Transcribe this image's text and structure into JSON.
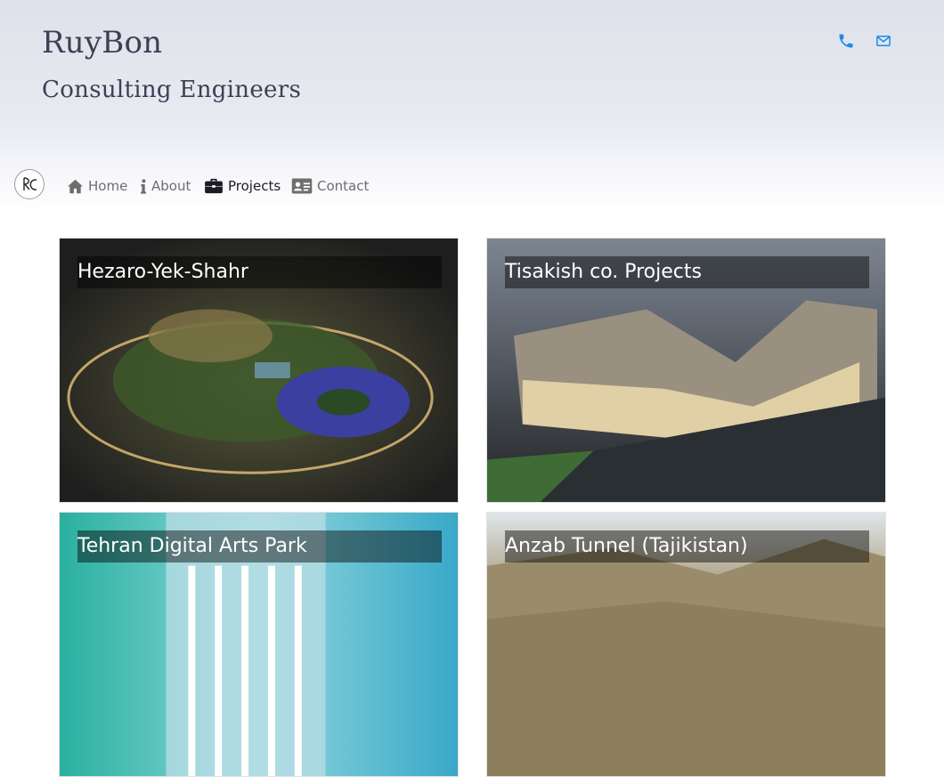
{
  "brand": {
    "title": "RuyBon",
    "subtitle": "Consulting Engineers",
    "logo_text": "RC"
  },
  "contact_icons": [
    {
      "icon": "phone-icon",
      "color": "#1a8cf0"
    },
    {
      "icon": "envelope-icon",
      "color": "#1a8cf0"
    }
  ],
  "nav": {
    "items": [
      {
        "label": "Home",
        "icon": "home-icon",
        "active": false
      },
      {
        "label": "About",
        "icon": "info-icon",
        "active": false
      },
      {
        "label": "Projects",
        "icon": "briefcase-icon",
        "active": true
      },
      {
        "label": "Contact",
        "icon": "address-card-icon",
        "active": false
      }
    ]
  },
  "projects": [
    {
      "title": "Hezaro-Yek-Shahr"
    },
    {
      "title": "Tisakish co. Projects"
    },
    {
      "title": "Tehran Digital Arts Park"
    },
    {
      "title": "Anzab Tunnel (Tajikistan)"
    }
  ],
  "colors": {
    "brand_text": "#3c3f55",
    "accent": "#1a8cf0",
    "nav_text": "#6e6e6e",
    "nav_active": "#1c1c24"
  }
}
